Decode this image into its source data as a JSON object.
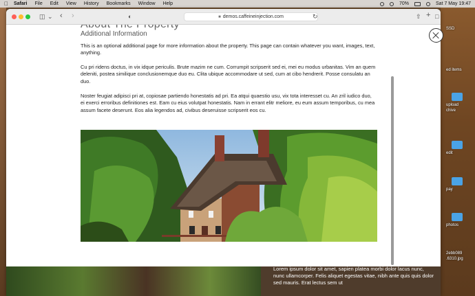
{
  "menubar": {
    "app": "Safari",
    "items": [
      "File",
      "Edit",
      "View",
      "History",
      "Bookmarks",
      "Window",
      "Help"
    ],
    "battery": "70%",
    "datetime": "Sat 7 May  19:47"
  },
  "browser": {
    "url": "demos.caffeineinjection.com"
  },
  "modal": {
    "title": "About The Property",
    "subtitle": "Additional Information",
    "paragraphs": [
      "This is an optional additional page for more information about the property. This page can contain whatever you want, images, text, anything.",
      "Cu pri ridens doctus, in vix idque periculis. Brute mazim ne cum. Corrumpit scripserit sed ei, mei eu modus urbanitas. Vim an quem deleniti, postea similique conclusionemque duo eu. Clita ubique accommodare ut sed, cum at cibo hendrerit. Posse consulatu an duo.",
      "Noster feugiat adipisci pri at, copiosae partiendo honestatis ad pri. Ea atqui quaestio usu, vix tota interesset cu. An zril iudico duo, ei exerci erroribus definitiones est. Eam cu eius volutpat honestatis. Nam in errant elitr meliore, eu eum assum temporibus, cu mea assum facete deserunt. Eos alia legendos ad, civibus deseruisse scripserit eos cu."
    ]
  },
  "background_page": {
    "text": "Lorem ipsum dolor sit amet, sapien platea morbi dolor lacus nunc, nunc ullamcorper. Felis aliquet egestas vitae, nibh ante quis quis dolor sed mauris. Erat lectus sem ut"
  },
  "desktop": {
    "items": [
      "SSD",
      "ed items",
      "upload\nchive",
      "edit",
      "pay",
      "photos",
      "2ebb089\n.6310.jpg"
    ]
  }
}
